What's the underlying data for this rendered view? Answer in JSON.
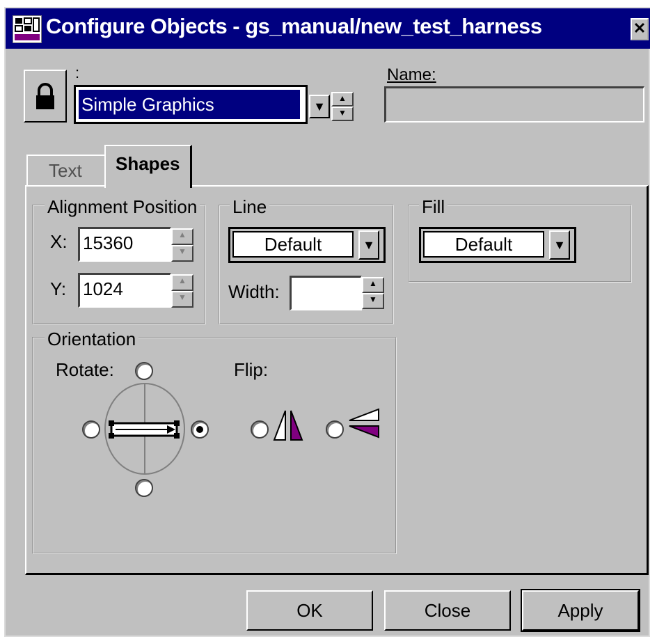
{
  "window": {
    "title": "Configure Objects - gs_manual/new_test_harness"
  },
  "header": {
    "selector_label": ":",
    "selector_value": "Simple Graphics",
    "name_label": "Name:",
    "name_value": ""
  },
  "tabs": [
    {
      "label": "Text",
      "active": false
    },
    {
      "label": "Shapes",
      "active": true
    }
  ],
  "alignment": {
    "title": "Alignment Position",
    "x_label": "X:",
    "x_value": "15360",
    "y_label": "Y:",
    "y_value": "1024"
  },
  "line": {
    "title": "Line",
    "style_value": "Default",
    "width_label": "Width:",
    "width_value": ""
  },
  "fill": {
    "title": "Fill",
    "style_value": "Default"
  },
  "orientation": {
    "title": "Orientation",
    "rotate_label": "Rotate:",
    "flip_label": "Flip:",
    "rotate_selected": "right"
  },
  "buttons": {
    "ok": "OK",
    "close": "Close",
    "apply": "Apply"
  },
  "colors": {
    "titlebar": "#000080",
    "dialog": "#c0c0c0",
    "selection": "#000080",
    "flip_accent": "#800080"
  },
  "icons": [
    "app-icon",
    "close-icon",
    "lock-icon",
    "dropdown-arrow-icon",
    "flip-horizontal-icon",
    "flip-vertical-icon"
  ]
}
